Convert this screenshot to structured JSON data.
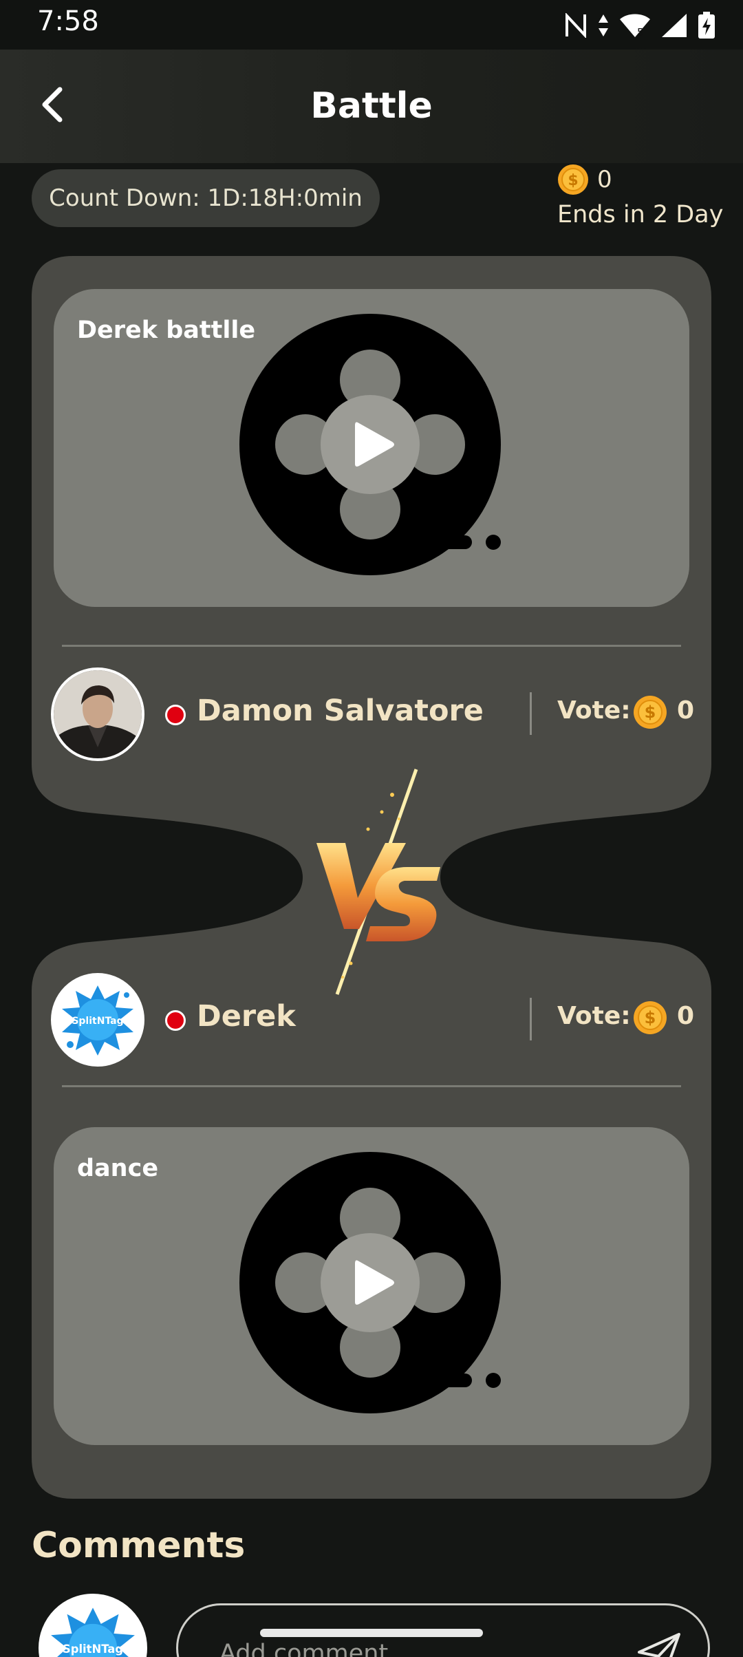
{
  "status_bar": {
    "time": "7:58"
  },
  "header": {
    "title": "Battle"
  },
  "countdown": {
    "label": "Count Down: 1D:18H:0min"
  },
  "balance": {
    "coins": "0",
    "ends_text": "Ends in 2 Day"
  },
  "battle": {
    "top": {
      "video_title": "Derek battlle",
      "player_name": "Damon Salvatore",
      "vote_label": "Vote:",
      "vote_count": "0"
    },
    "bottom": {
      "video_title": "dance",
      "player_name": "Derek",
      "vote_label": "Vote:",
      "vote_count": "0"
    },
    "avatar_logo_text": "SplitNTag"
  },
  "comments": {
    "title": "Comments",
    "placeholder": "Add comment"
  },
  "colors": {
    "accent_cream": "#f2e4c4",
    "card_bg": "#4a4a45",
    "video_bg": "#7d7e78",
    "coin_gold": "#f5a623",
    "live_red": "#e00010"
  }
}
